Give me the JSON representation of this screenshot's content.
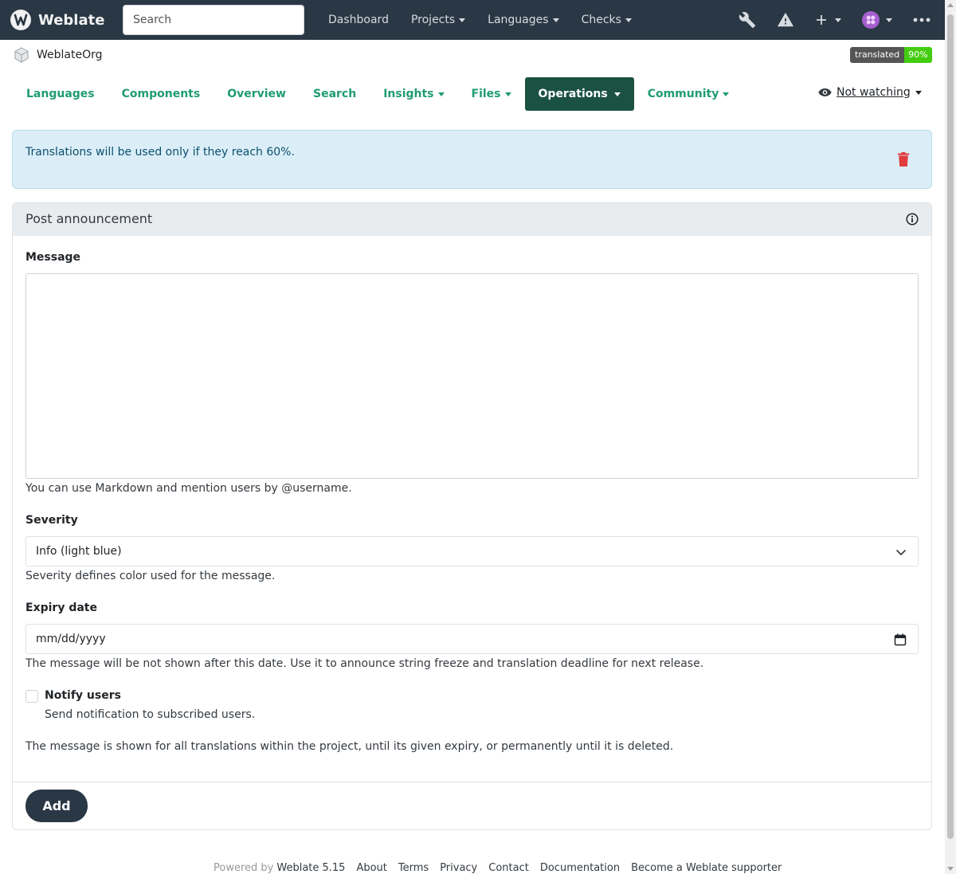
{
  "navbar": {
    "brand": "Weblate",
    "search_placeholder": "Search",
    "links": [
      {
        "label": "Dashboard"
      },
      {
        "label": "Projects"
      },
      {
        "label": "Languages"
      },
      {
        "label": "Checks"
      }
    ],
    "icons": [
      "wrench-icon",
      "warning-icon",
      "plus-icon",
      "avatar",
      "more-icon"
    ]
  },
  "breadcrumb": {
    "project": "WeblateOrg"
  },
  "badge": {
    "label": "translated",
    "value": "90%"
  },
  "tabs": [
    {
      "label": "Languages"
    },
    {
      "label": "Components"
    },
    {
      "label": "Overview"
    },
    {
      "label": "Search"
    },
    {
      "label": "Insights"
    },
    {
      "label": "Files"
    },
    {
      "label": "Operations",
      "active": true
    },
    {
      "label": "Community"
    }
  ],
  "watch": {
    "label": "Not watching"
  },
  "alert": {
    "text": "Translations will be used only if they reach 60%."
  },
  "form": {
    "title": "Post announcement",
    "message_label": "Message",
    "message_value": "",
    "message_help": "You can use Markdown and mention users by @username.",
    "severity_label": "Severity",
    "severity_value": "Info (light blue)",
    "severity_help": "Severity defines color used for the message.",
    "expiry_label": "Expiry date",
    "expiry_placeholder": "mm/dd/yyyy",
    "expiry_help": "The message will be not shown after this date. Use it to announce string freeze and translation deadline for next release.",
    "notify_label": "Notify users",
    "notify_help": "Send notification to subscribed users.",
    "notify_checked": false,
    "scope_help": "The message is shown for all translations within the project, until its given expiry, or permanently until it is deleted.",
    "submit_label": "Add"
  },
  "footer": {
    "powered_by": "Powered by",
    "version": "Weblate 5.15",
    "links": [
      "About",
      "Terms",
      "Privacy",
      "Contact",
      "Documentation",
      "Become a Weblate supporter"
    ]
  },
  "colors": {
    "navbar": "#2a3744",
    "accent": "#1f9c72",
    "active_tab": "#1b5142",
    "alert_bg": "#dbeef8",
    "danger": "#e03c3c",
    "badge_ok": "#44cc11"
  }
}
